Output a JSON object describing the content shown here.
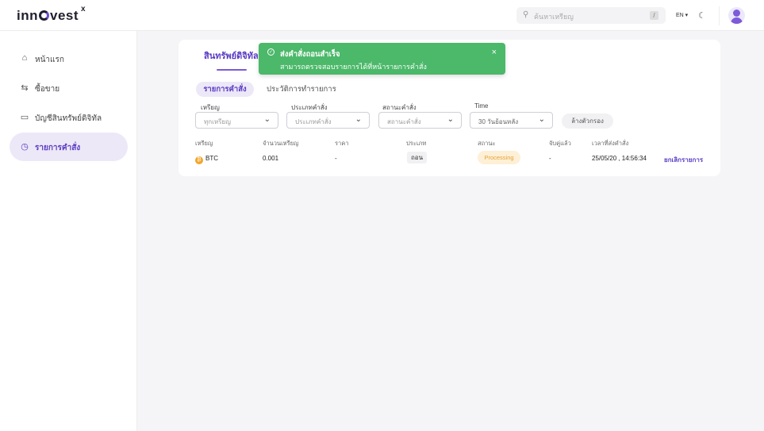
{
  "brand": {
    "name_part1": "inn",
    "name_part2": "vest",
    "superscript": "x"
  },
  "header": {
    "search_placeholder": "ค้นหาเหรียญ",
    "search_shortcut": "/",
    "language": "EN"
  },
  "sidebar": {
    "items": [
      {
        "label": "หน้าแรก",
        "icon": "home-icon"
      },
      {
        "label": "ซื้อขาย",
        "icon": "swap-icon"
      },
      {
        "label": "บัญชีสินทรัพย์ดิจิทัล",
        "icon": "wallet-icon"
      },
      {
        "label": "รายการคำสั่ง",
        "icon": "clock-icon",
        "active": true
      }
    ]
  },
  "main": {
    "tab": "สินทรัพย์ดิจิทัล",
    "subtabs": [
      "รายการคำสั่ง",
      "ประวัติการทำรายการ"
    ],
    "filters": [
      {
        "label": "เหรียญ",
        "value": "ทุกเหรียญ"
      },
      {
        "label": "ประเภทคำสั่ง",
        "value": "ประเภทคำสั่ง"
      },
      {
        "label": "สถานะคำสั่ง",
        "value": "สถานะคำสั่ง"
      },
      {
        "label": "Time",
        "value": "30 วันย้อนหลัง"
      }
    ],
    "clear_filter": "ล้างตัวกรอง",
    "table": {
      "headers": [
        "เหรียญ",
        "จำนวนเหรียญ",
        "ราคา",
        "ประเภท",
        "สถานะ",
        "จับคู่แล้ว",
        "เวลาที่ส่งคำสั่ง"
      ],
      "rows": [
        {
          "coin": "BTC",
          "amount": "0.001",
          "price": "-",
          "type": "ถอน",
          "status": "Processing",
          "matched": "-",
          "time": "25/05/20 , 14:56:34",
          "action": "ยกเลิกรายการ"
        }
      ]
    }
  },
  "toast": {
    "title": "ส่งคำสั่งถอนสำเร็จ",
    "message": "สามารถตรวจสอบรายการได้ที่หน้ารายการคำสั่ง",
    "close": "×"
  },
  "colors": {
    "accent": "#5b3cc4",
    "toast": "#4bb86a",
    "status_processing": "#e8a23a",
    "coin_btc": "#f2a52a"
  }
}
